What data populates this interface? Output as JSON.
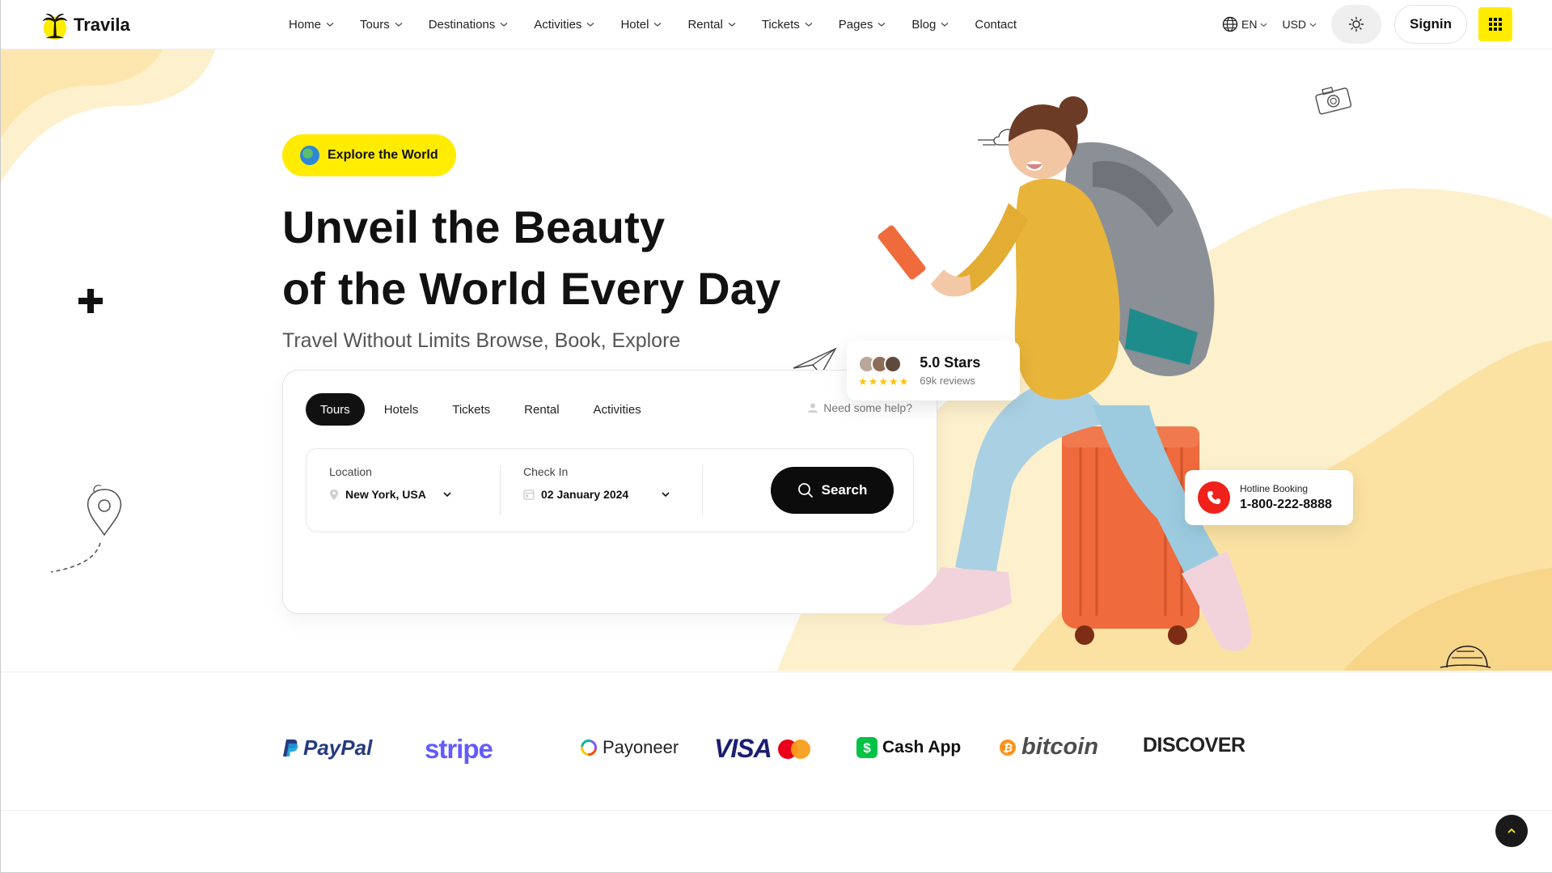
{
  "brand": {
    "name": "Travila"
  },
  "nav": {
    "items": [
      {
        "label": "Home",
        "has_dropdown": true
      },
      {
        "label": "Tours",
        "has_dropdown": true
      },
      {
        "label": "Destinations",
        "has_dropdown": true
      },
      {
        "label": "Activities",
        "has_dropdown": true
      },
      {
        "label": "Hotel",
        "has_dropdown": true
      },
      {
        "label": "Rental",
        "has_dropdown": true
      },
      {
        "label": "Tickets",
        "has_dropdown": true
      },
      {
        "label": "Pages",
        "has_dropdown": true
      },
      {
        "label": "Blog",
        "has_dropdown": true
      },
      {
        "label": "Contact",
        "has_dropdown": false
      }
    ]
  },
  "header": {
    "language": "EN",
    "currency": "USD",
    "signin_label": "Signin",
    "icons": {
      "language": "globe-icon",
      "theme": "sun-icon",
      "menu": "grid-icon"
    }
  },
  "hero": {
    "badge": "Explore the World",
    "title_line1": "Unveil the Beauty",
    "title_line2": "of the World Every Day",
    "subtitle": "Travel Without Limits Browse, Book, Explore"
  },
  "search": {
    "tabs": [
      {
        "label": "Tours",
        "active": true
      },
      {
        "label": "Hotels",
        "active": false
      },
      {
        "label": "Tickets",
        "active": false
      },
      {
        "label": "Rental",
        "active": false
      },
      {
        "label": "Activities",
        "active": false
      }
    ],
    "help_text": "Need some help?",
    "location_label": "Location",
    "location_value": "New York, USA",
    "checkin_label": "Check In",
    "checkin_value": "02 January 2024",
    "button_label": "Search"
  },
  "review": {
    "title": "5.0 Stars",
    "subtitle": "69k reviews",
    "stars": 5
  },
  "hotline": {
    "label": "Hotline Booking",
    "number": "1-800-222-8888"
  },
  "partners": [
    {
      "name": "PayPal"
    },
    {
      "name": "stripe"
    },
    {
      "name": "Payoneer"
    },
    {
      "name": "VISA"
    },
    {
      "name": "Cash App"
    },
    {
      "name": "bitcoin"
    },
    {
      "name": "DISCOVER"
    }
  ],
  "colors": {
    "accent": "#ffec00",
    "dark": "#111111",
    "blob": "#fdebb8",
    "hotline_red": "#f0201a"
  }
}
